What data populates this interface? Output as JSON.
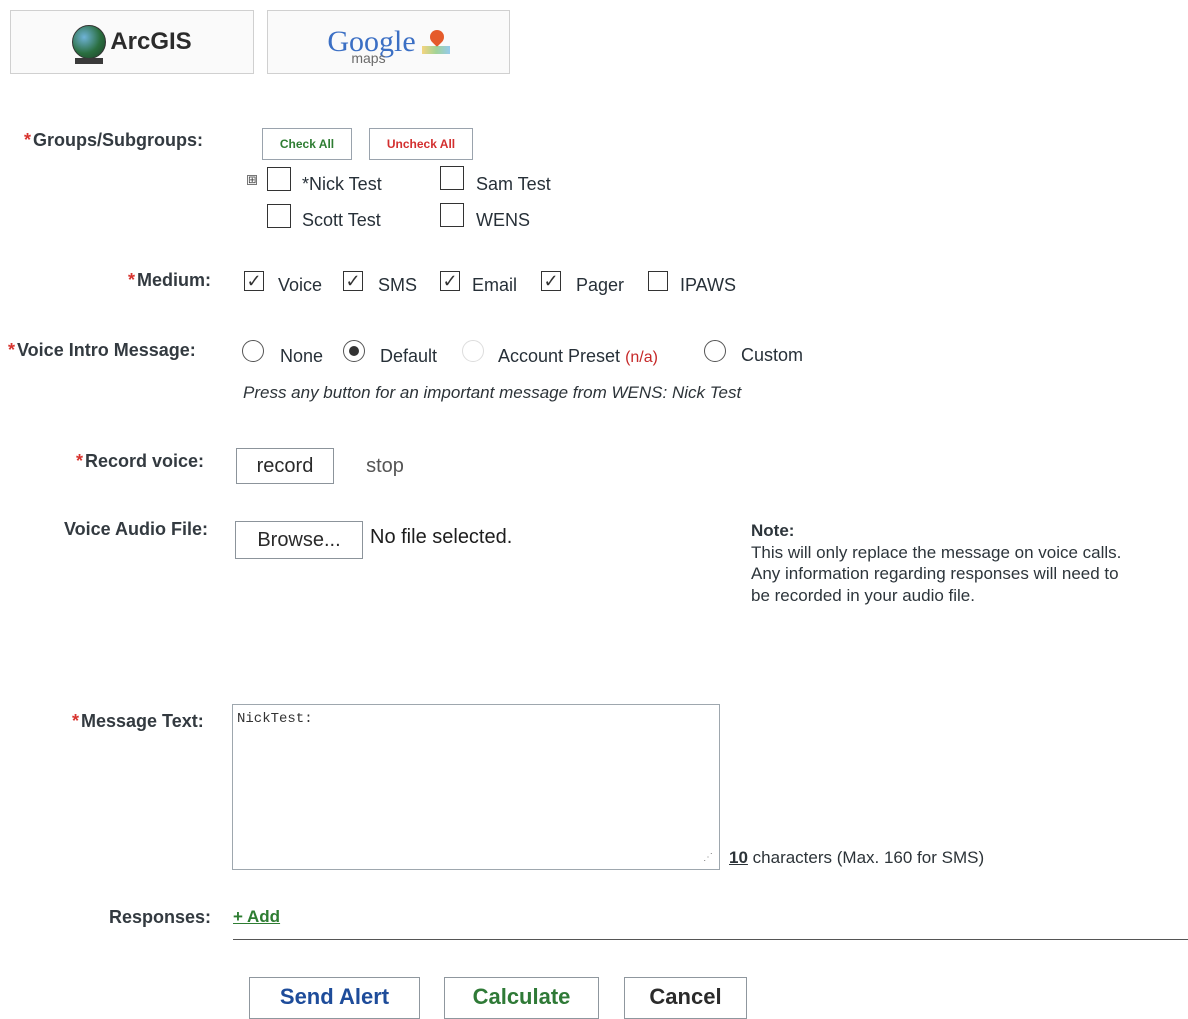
{
  "maps": {
    "arcgis_label": "ArcGIS",
    "google_label": "Google",
    "google_sub": "maps"
  },
  "groups": {
    "label": "Groups/Subgroups:",
    "check_all": "Check All",
    "uncheck_all": "Uncheck All",
    "expand_symbol": "⊞",
    "items": [
      {
        "label": "*Nick Test",
        "checked": false
      },
      {
        "label": "Sam Test",
        "checked": false
      },
      {
        "label": "Scott Test",
        "checked": false
      },
      {
        "label": "WENS",
        "checked": false
      }
    ]
  },
  "medium": {
    "label": "Medium:",
    "options": [
      {
        "label": "Voice",
        "checked": true
      },
      {
        "label": "SMS",
        "checked": true
      },
      {
        "label": "Email",
        "checked": true
      },
      {
        "label": "Pager",
        "checked": true
      },
      {
        "label": "IPAWS",
        "checked": false
      }
    ]
  },
  "voice_intro": {
    "label": "Voice Intro Message:",
    "options": [
      {
        "label": "None",
        "selected": false
      },
      {
        "label": "Default",
        "selected": true
      },
      {
        "label": "Account Preset",
        "selected": false,
        "disabled": true,
        "suffix": "(n/a)"
      },
      {
        "label": "Custom",
        "selected": false
      }
    ],
    "preview": "Press any button for an important message from WENS: Nick Test"
  },
  "record": {
    "label": "Record voice:",
    "record_btn": "record",
    "stop_btn": "stop"
  },
  "audio": {
    "label": "Voice Audio File:",
    "browse_btn": "Browse...",
    "file_status": "No file selected.",
    "note_title": "Note:",
    "note_lines": [
      "This will only replace the message on voice calls.",
      "Any information regarding responses will need to",
      "be recorded in your audio file."
    ]
  },
  "message": {
    "label": "Message Text:",
    "value": "NickTest:",
    "char_count": "10",
    "char_suffix": "characters (Max. 160 for SMS)"
  },
  "responses": {
    "label": "Responses:",
    "add_link": "+ Add"
  },
  "actions": {
    "send": "Send Alert",
    "calculate": "Calculate",
    "cancel": "Cancel"
  },
  "colors": {
    "required": "#d8342f",
    "check_all": "#2e7d32",
    "uncheck_all": "#d32f2f",
    "send": "#1e4c9a",
    "calculate": "#2f7a37"
  }
}
